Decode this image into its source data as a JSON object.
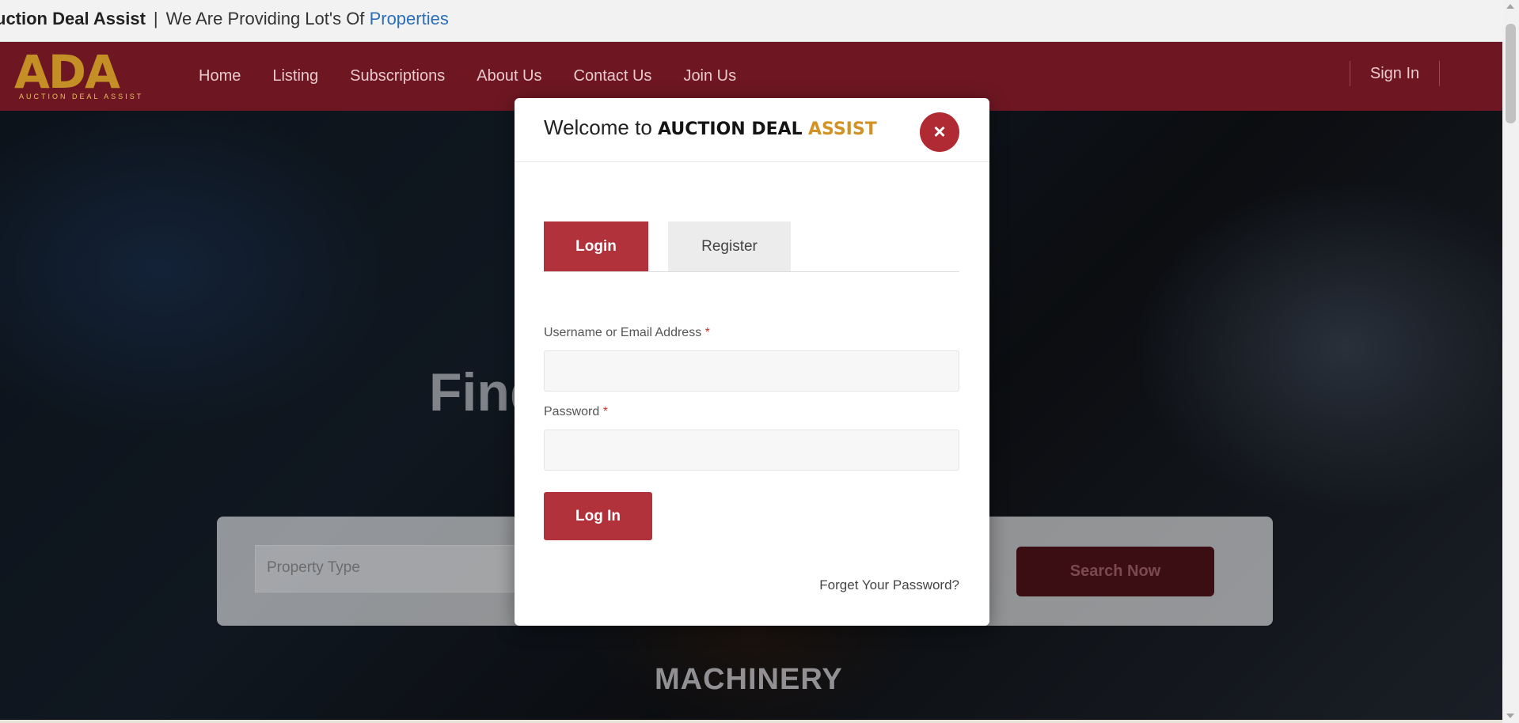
{
  "ticker": {
    "brand": "uction Deal Assist",
    "separator": "|",
    "text": "We Are Providing Lot's Of",
    "link": "Properties"
  },
  "header": {
    "logo_mark": "ADA",
    "logo_sub": "AUCTION DEAL ASSIST",
    "nav": [
      "Home",
      "Listing",
      "Subscriptions",
      "About Us",
      "Contact Us",
      "Join Us"
    ],
    "sign_in": "Sign In"
  },
  "hero": {
    "title": "Find Your Auction",
    "property_type_placeholder": "Property Type",
    "search_button": "Search Now",
    "section_label": "MACHINERY"
  },
  "modal": {
    "title_prefix": "Welcome to",
    "title_dark": "AUCTION DEAL",
    "title_gold": "ASSIST",
    "close_label": "×",
    "tabs": {
      "login": "Login",
      "register": "Register"
    },
    "username_label": "Username or Email Address",
    "password_label": "Password",
    "required_marker": "*",
    "username_value": "",
    "password_value": "",
    "login_button": "Log In",
    "forget_link": "Forget Your Password?"
  },
  "colors": {
    "brand_red": "#b1323b",
    "header_bg": "#6e1722",
    "gold": "#d39224",
    "link_blue": "#2a6fb8"
  }
}
